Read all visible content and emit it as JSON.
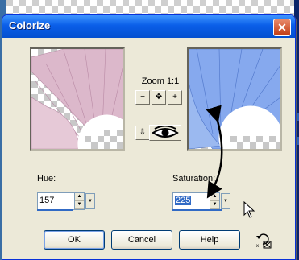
{
  "dialog": {
    "title": "Colorize",
    "close_glyph": "✕"
  },
  "zoom": {
    "label": "Zoom 1:1",
    "buttons": [
      {
        "name": "zoom-out-icon",
        "glyph": "−"
      },
      {
        "name": "pan-icon",
        "glyph": "✥"
      },
      {
        "name": "zoom-in-icon",
        "glyph": "+"
      }
    ],
    "proof_glyph": "⇩"
  },
  "hue": {
    "label": "Hue:",
    "value": "157"
  },
  "saturation": {
    "label": "Saturation:",
    "value": "225"
  },
  "buttons": {
    "ok": "OK",
    "cancel": "Cancel",
    "help": "Help"
  },
  "colors": {
    "title_bar": "#0a5ee8",
    "dialog_bg": "#ece9d8",
    "preview_before": "#d9b4c8",
    "preview_after": "#7fa3ea",
    "selection": "#316ac5",
    "close": "#c23c14"
  }
}
